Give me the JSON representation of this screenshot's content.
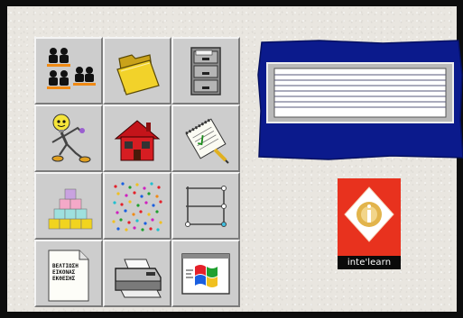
{
  "launcher": {
    "tiles": [
      {
        "icon": "people-group-icon"
      },
      {
        "icon": "open-folder-icon"
      },
      {
        "icon": "filing-cabinet-icon"
      },
      {
        "icon": "lightbulb-character-icon"
      },
      {
        "icon": "house-icon"
      },
      {
        "icon": "notepad-pencil-icon"
      },
      {
        "icon": "building-blocks-icon"
      },
      {
        "icon": "confetti-icon"
      },
      {
        "icon": "shelf-icon"
      },
      {
        "icon": "document-icon",
        "doc_lines": [
          "ΒΕΛΤΙΩΣΗ",
          "ΕΙΚΟΝΑΣ",
          "ΕΚΘΕΣΗΣ"
        ]
      },
      {
        "icon": "printer-icon"
      },
      {
        "icon": "windows-flag-icon"
      }
    ]
  },
  "lined_board": {
    "line_count": 7
  },
  "brand": {
    "name": "inte'learn",
    "accent_color": "#e8321e"
  },
  "colors": {
    "board_blue": "#0b1a8c",
    "tile_gray": "#cdcdcd",
    "background": "#e9e6e0"
  }
}
